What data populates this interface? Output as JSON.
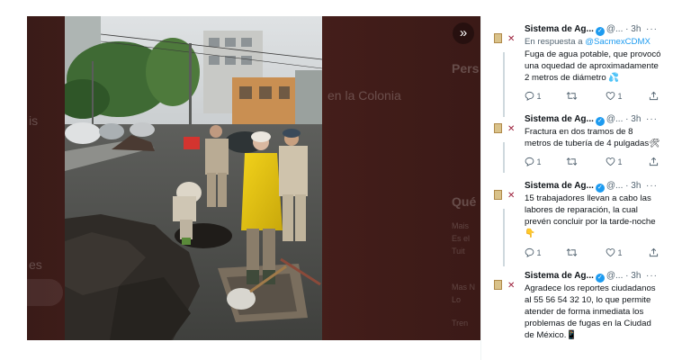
{
  "viewer": {
    "background_text": {
      "heading_fragment": "en la Colonia",
      "left_fragment": "is",
      "left_fragment_2": "es",
      "right_heading": "Pers",
      "right_heading_2": "Qué",
      "small_lines": [
        "Mais",
        "Es el",
        "Tuit",
        "Mas N",
        "Lo",
        "Tren"
      ]
    },
    "expand_icon": "chevrons-right-icon"
  },
  "tweets": [
    {
      "name": "Sistema de Ag...",
      "handle": "@...",
      "time": "· 3h",
      "more": "···",
      "reply_prefix": "En respuesta a",
      "reply_handle": "@SacmexCDMX",
      "text": "Fuga de agua potable, que provocó una oquedad de aproximadamente 2 metros de diámetro 💦",
      "replies": "1",
      "retweets": "",
      "likes": "1"
    },
    {
      "name": "Sistema de Ag...",
      "handle": "@...",
      "time": "· 3h",
      "more": "···",
      "text": "Fractura en dos tramos de 8 metros de tubería de 4 pulgadas🛠",
      "replies": "1",
      "retweets": "",
      "likes": "1"
    },
    {
      "name": "Sistema de Ag...",
      "handle": "@...",
      "time": "· 3h",
      "more": "···",
      "text": "15 trabajadores llevan a cabo las labores de reparación, la cual prevén concluir por la tarde-noche 👇",
      "replies": "1",
      "retweets": "",
      "likes": "1"
    },
    {
      "name": "Sistema de Ag...",
      "handle": "@...",
      "time": "· 3h",
      "more": "···",
      "text": "Agradece los reportes ciudadanos al 55 56 54 32 10, lo que permite atender de forma inmediata los problemas de fugas en la Ciudad de México.📱"
    }
  ]
}
